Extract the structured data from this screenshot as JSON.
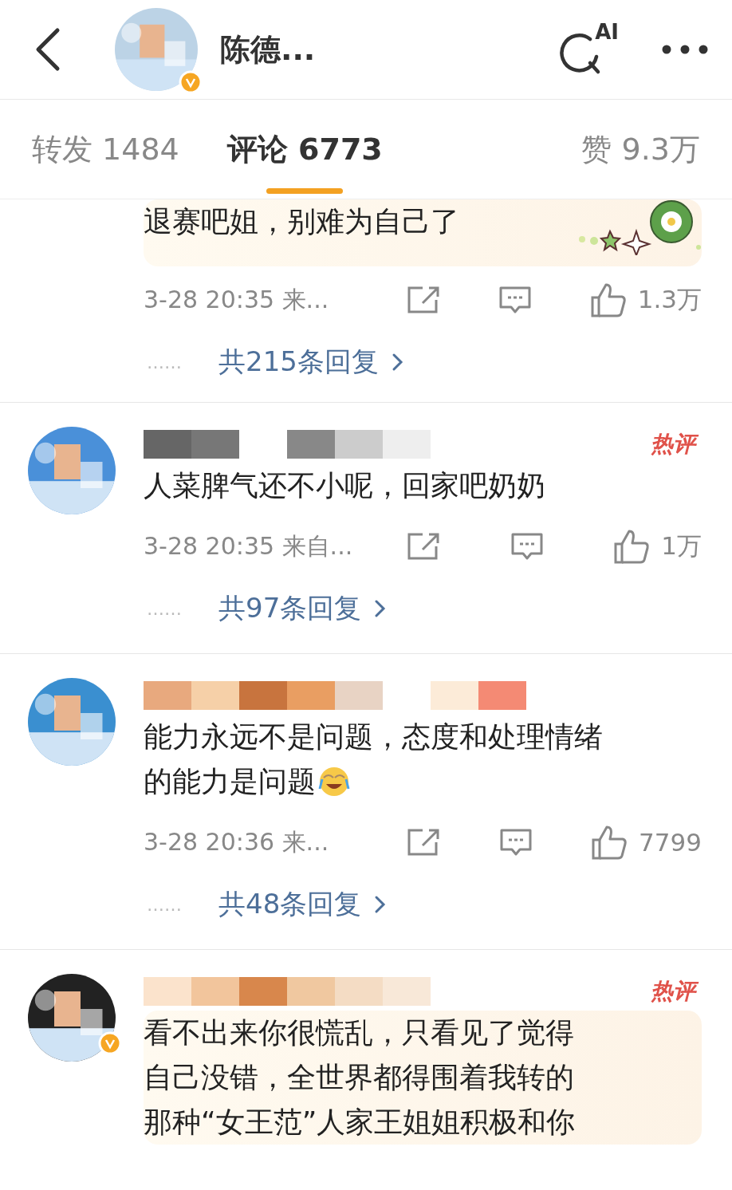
{
  "header": {
    "title": "陈德...",
    "verified": true,
    "ai_label": "AI"
  },
  "tabs": [
    {
      "label": "转发 1484",
      "selected": false
    },
    {
      "label": "评论 6773",
      "selected": true
    },
    {
      "label": "赞 9.3万",
      "selected": false
    }
  ],
  "comments": [
    {
      "verified": false,
      "bubble": true,
      "flower": true,
      "lines": [
        "退赛吧姐，别难为自己了"
      ],
      "time": "3-28 20:35 来...",
      "likes": "1.3万",
      "replies": "共215条回复",
      "dots": "……"
    },
    {
      "has_avatar": true,
      "hot_label": "热评",
      "verified": false,
      "bubble": false,
      "flower": false,
      "lines": [
        "人菜脾气还不小呢，回家吧奶奶"
      ],
      "time": "3-28 20:35 来自...",
      "likes": "1万",
      "replies": "共97条回复",
      "dots": "……"
    },
    {
      "has_avatar": true,
      "verified": false,
      "bubble": false,
      "flower": false,
      "lines": [
        "能力永远不是问题，态度和处理情绪",
        "的能力是问题"
      ],
      "emoji": true,
      "time": "3-28 20:36 来...",
      "likes": "7799",
      "replies": "共48条回复",
      "dots": "……"
    },
    {
      "has_avatar": true,
      "hot_label": "热评",
      "verified": true,
      "bubble": true,
      "flower": false,
      "lines": [
        "看不出来你很慌乱，只看见了觉得",
        "自己没错，全世界都得围着我转的",
        "那种“女王范”人家王姐姐积极和你"
      ]
    }
  ]
}
